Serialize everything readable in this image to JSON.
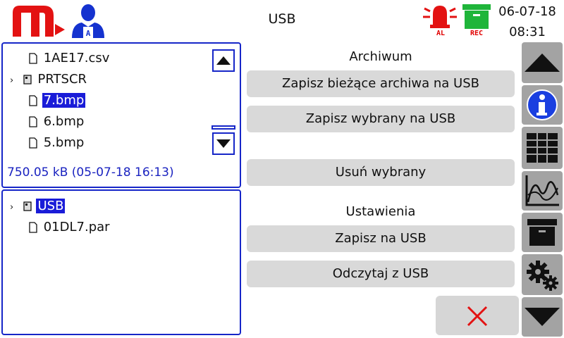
{
  "header": {
    "title": "USB",
    "date": "06-07-18",
    "time": "08:31",
    "alarm_badge": "AL",
    "rec_badge": "REC",
    "icons": [
      "logo-m-icon",
      "user-icon",
      "alarm-icon",
      "archive-rec-icon"
    ]
  },
  "file_browser": {
    "rows": [
      {
        "type": "file",
        "name": "1AE17.csv",
        "selected": false
      },
      {
        "type": "folder",
        "name": "PRTSCR",
        "selected": false
      },
      {
        "type": "file",
        "name": "7.bmp",
        "selected": true
      },
      {
        "type": "file",
        "name": "6.bmp",
        "selected": false
      },
      {
        "type": "file",
        "name": "5.bmp",
        "selected": false
      }
    ],
    "status": "750.05 kB (05-07-18 16:13)"
  },
  "usb_browser": {
    "rows": [
      {
        "type": "folder",
        "name": "USB",
        "selected": true
      },
      {
        "type": "file",
        "name": "01DL7.par",
        "selected": false
      }
    ]
  },
  "actions": {
    "archive_title": "Archiwum",
    "save_current": "Zapisz bieżące archiwa na USB",
    "save_selected": "Zapisz wybrany na USB",
    "delete_selected": "Usuń wybrany",
    "settings_title": "Ustawienia",
    "save_to_usb": "Zapisz na USB",
    "read_from_usb": "Odczytaj z USB"
  },
  "colors": {
    "accent_blue": "#1626c8",
    "selection": "#1a1cd8",
    "logo_red": "#e31212",
    "rec_green": "#1fb53a",
    "toolbar_gray": "#a3a3a3",
    "button_gray": "#d9d9d9"
  }
}
